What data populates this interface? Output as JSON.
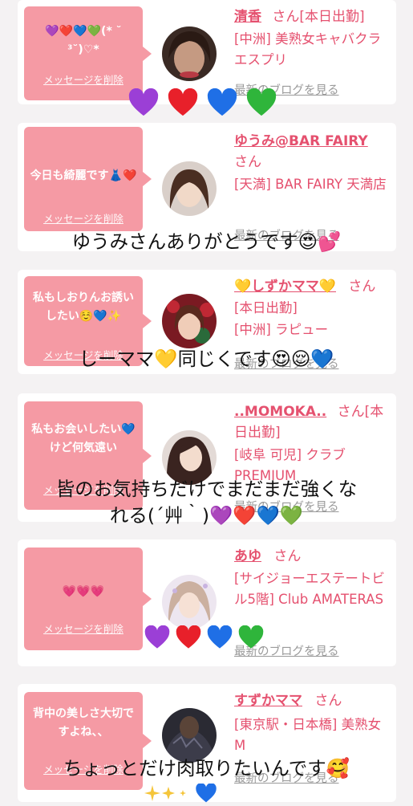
{
  "cards": [
    {
      "message": "💜❤️💙💚(* ˘ ³˘)♡*",
      "delete_label": "メッセージを削除",
      "name": "清香",
      "suffix": "さん[本日出勤]",
      "shop": "[中洲] 美熟女キャバクラ エスプリ",
      "blog": "最新のブログを見る"
    },
    {
      "message": "今日も綺麗です👗❤️",
      "delete_label": "メッセージを削除",
      "name": "ゆうみ@BAR FAIRY",
      "suffix": "さん",
      "shop": "[天満] BAR FAIRY 天満店",
      "blog": "最新のブログを見る"
    },
    {
      "message": "私もしおりんお誘いしたい☺️💙✨",
      "delete_label": "メッセージを削除",
      "name": "💛しずかママ💛",
      "suffix": "さん",
      "status": "[本日出勤]",
      "shop": "[中洲] ラピュー",
      "blog": "最新のブログを見る"
    },
    {
      "message": "私もお会いしたい💙けど何気遠い",
      "delete_label": "メッセージを削除",
      "name": "..MOMOKA..",
      "suffix": "さん[本日出勤]",
      "shop": "[岐阜 可児] クラブ PREMIUM",
      "blog": "最新のブログを見る"
    },
    {
      "message": "💗💗💗",
      "delete_label": "メッセージを削除",
      "name": "あゆ",
      "suffix": "さん",
      "shop": "[サイジョーエステートビル5階] Club AMATERAS",
      "blog": "最新のブログを見る"
    },
    {
      "message": "背中の美しさ大切ですよね、、",
      "delete_label": "メッセージを削除",
      "name": "すずかママ",
      "suffix": "さん",
      "shop": "[東京駅・日本橋] 美熟女 M",
      "blog": "最新のブログを見る"
    }
  ],
  "captions": {
    "c1": "ゆうみさんありがとうです😍💕",
    "c2": "しーママ💛同じくです😍😌💙",
    "c3_line1": "皆のお気持ちだけでまだまだ強くな",
    "c3_line2": "れる(´艸｀)💜❤️💙💚",
    "c4": "ちょっとだけ肉取りたいんです🥰"
  },
  "colors": {
    "accent": "#e5516f",
    "bubble": "#f59aa4",
    "purple": "#9b3fd6",
    "red": "#e8202a",
    "blue": "#1f6fe6",
    "green": "#2fb53b",
    "yellow": "#f5c53a"
  }
}
